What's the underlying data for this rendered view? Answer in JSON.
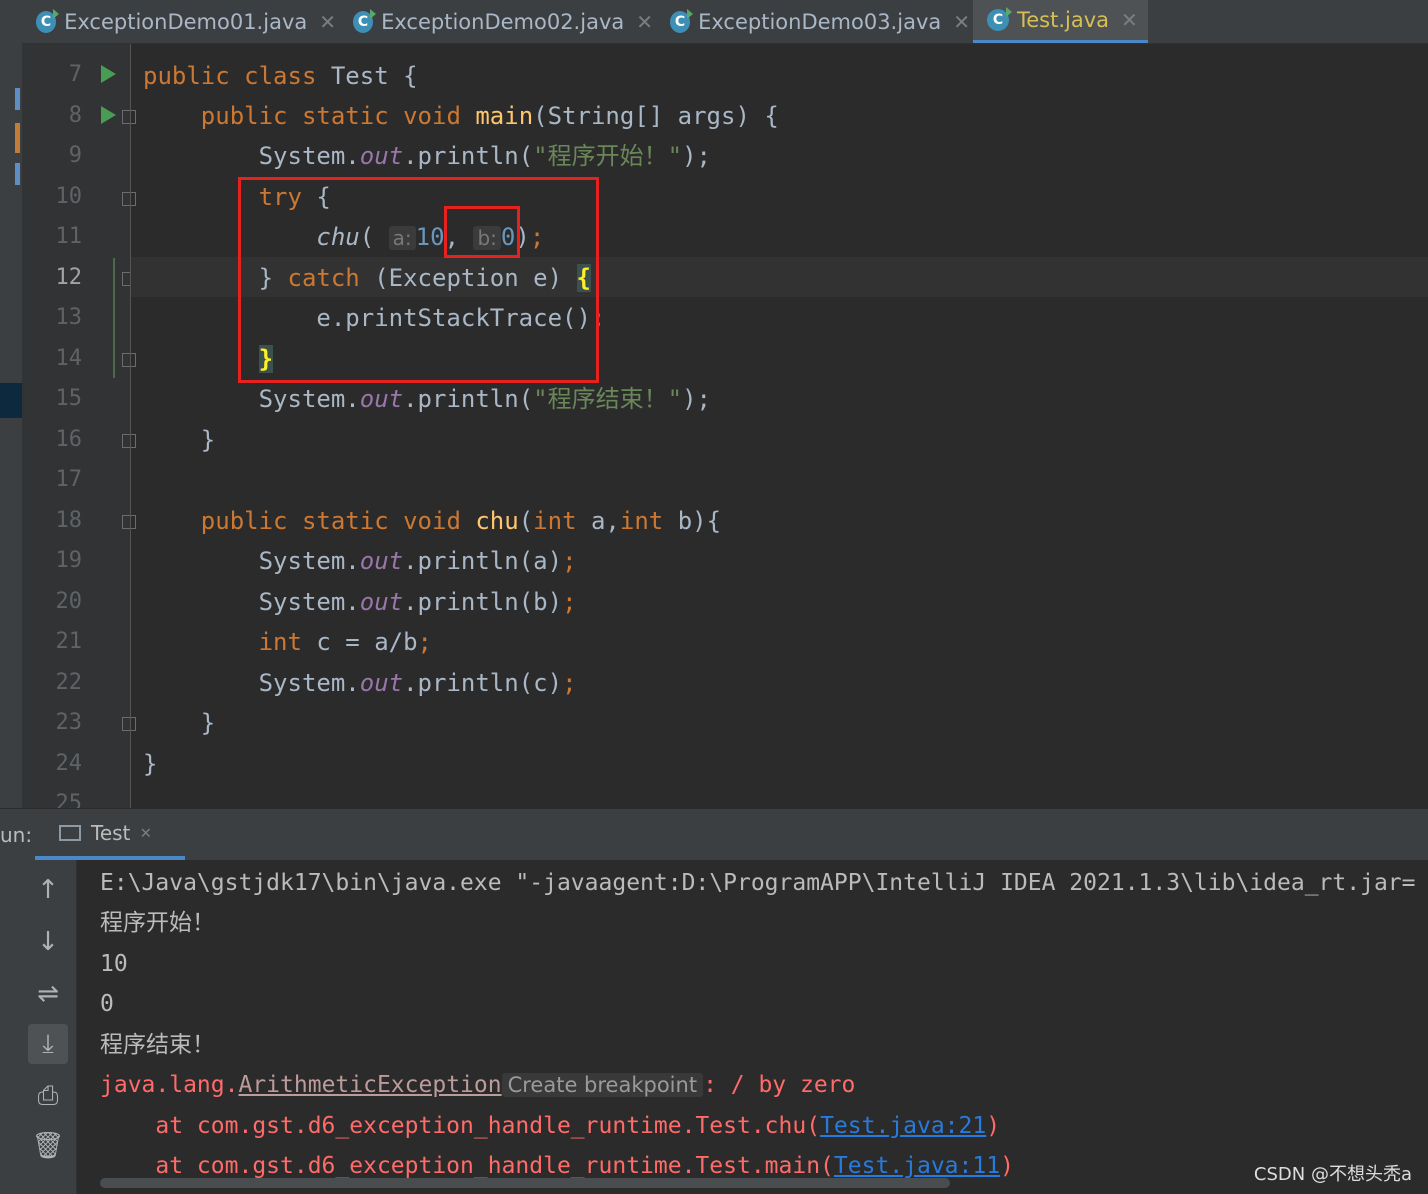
{
  "tabs": [
    {
      "label": "ExceptionDemo01.java",
      "active": false
    },
    {
      "label": "ExceptionDemo02.java",
      "active": false
    },
    {
      "label": "ExceptionDemo03.java",
      "active": false
    },
    {
      "label": "Test.java",
      "active": true
    }
  ],
  "editor": {
    "current_line": "12",
    "line_numbers": [
      "7",
      "8",
      "9",
      "10",
      "11",
      "12",
      "13",
      "14",
      "15",
      "16",
      "17",
      "18",
      "19",
      "20",
      "21",
      "22",
      "23",
      "24",
      "25"
    ],
    "code": {
      "l7": {
        "kw1": "public",
        "kw2": "class",
        "rest": " Test {"
      },
      "l8": {
        "kw1": "public",
        "kw2": "static",
        "kw3": "void",
        "fn": "main",
        "rest": "(String[] args) {"
      },
      "l9": {
        "pre": "System.",
        "field": "out",
        "call": ".println(",
        "str": "\"程序开始！\"",
        "end": ");"
      },
      "l10": {
        "kw": "try",
        "rest": " {"
      },
      "l11": {
        "fn": "chu",
        "open": "(",
        "hint_a": "a:",
        "val_a": "10",
        "comma": ",",
        "hint_b": "b:",
        "val_b": "0",
        "close": ")",
        "semi": ";"
      },
      "l12": {
        "pre": "} ",
        "kw": "catch",
        "rest": " (Exception e) ",
        "brace": "{"
      },
      "l13": {
        "call": "e.printStackTrace()",
        "semi": ";"
      },
      "l14": {
        "brace": "}"
      },
      "l15": {
        "pre": "System.",
        "field": "out",
        "call": ".println(",
        "str": "\"程序结束！\"",
        "end": ");"
      },
      "l16": {
        "text": "}"
      },
      "l18": {
        "kw1": "public",
        "kw2": "static",
        "kw3": "void",
        "fn": "chu",
        "open": "(",
        "kw4": "int",
        "mid": " a,",
        "kw5": "int",
        "rest": " b){"
      },
      "l19": {
        "pre": "System.",
        "field": "out",
        "call": ".println(a)",
        "semi": ";"
      },
      "l20": {
        "pre": "System.",
        "field": "out",
        "call": ".println(b)",
        "semi": ";"
      },
      "l21": {
        "kw": "int",
        "rest": " c = a/b",
        "semi": ";"
      },
      "l22": {
        "pre": "System.",
        "field": "out",
        "call": ".println(c)",
        "semi": ";"
      },
      "l23": {
        "text": "}"
      },
      "l24": {
        "text": "}"
      }
    }
  },
  "run_panel": {
    "label": "un:",
    "tab_label": "Test",
    "console_lines": {
      "cmd": "E:\\Java\\gstjdk17\\bin\\java.exe \"-javaagent:D:\\ProgramAPP\\IntelliJ IDEA 2021.1.3\\lib\\idea_rt.jar=",
      "out1": "程序开始！",
      "out2": "10",
      "out3": "0",
      "out4": "程序结束！",
      "exc_pkg": "java.lang.",
      "exc_class": "ArithmeticException",
      "create_breakpoint": "Create breakpoint",
      "exc_msg": ": / by zero",
      "st1_pre": "    at com.gst.d6_exception_handle_runtime.Test.chu(",
      "st1_link": "Test.java:21",
      "st1_end": ")",
      "st2_pre": "    at com.gst.d6_exception_handle_runtime.Test.main(",
      "st2_link": "Test.java:11",
      "st2_end": ")"
    },
    "tools": [
      "up-arrow-icon",
      "down-arrow-icon",
      "soft-wrap-icon",
      "scroll-to-end-icon",
      "print-icon",
      "trash-icon"
    ]
  },
  "watermark": "CSDN @不想头秃a",
  "colors": {
    "keyword": "#cc7832",
    "function": "#ffc66d",
    "string": "#6a8759",
    "field": "#9876aa",
    "number": "#6897bb",
    "error": "#ff6b68",
    "link": "#287bde",
    "highlight_box": "#e8211f"
  }
}
